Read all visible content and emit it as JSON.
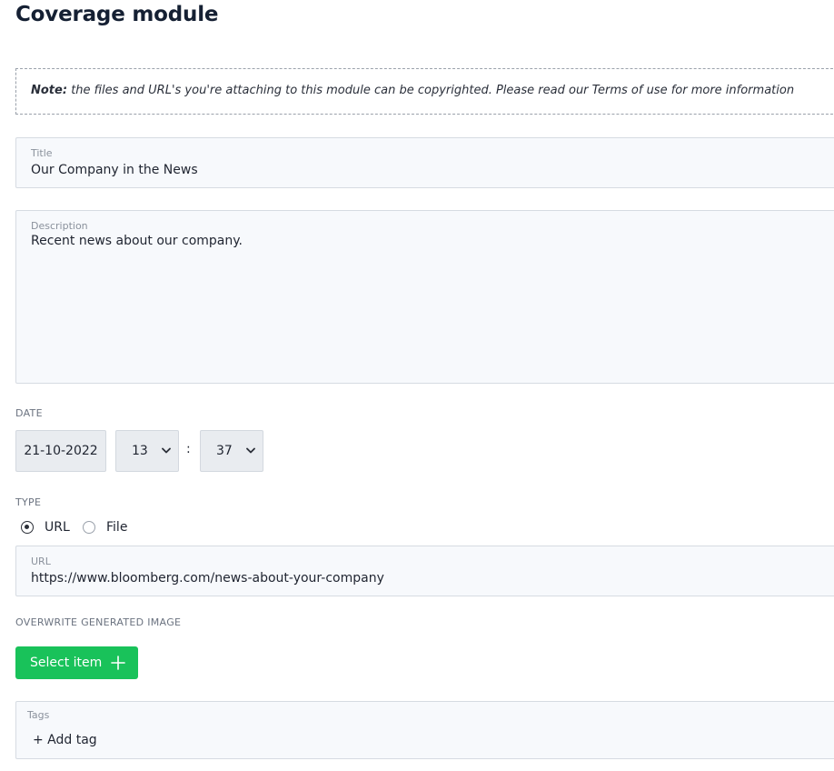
{
  "page": {
    "title": "Coverage module"
  },
  "note": {
    "prefix": "Note:",
    "text": "the files and URL's you're attaching to this module can be copyrighted. Please read our Terms of use for more information"
  },
  "title_field": {
    "label": "Title",
    "value": "Our Company in the News"
  },
  "description_field": {
    "label": "Description",
    "value": "Recent news about our company."
  },
  "date": {
    "section_label": "DATE",
    "date_value": "21-10-2022",
    "hour_value": "13",
    "separator": ":",
    "minute_value": "37"
  },
  "type": {
    "section_label": "TYPE",
    "options": [
      {
        "label": "URL",
        "selected": true
      },
      {
        "label": "File",
        "selected": false
      }
    ]
  },
  "url_field": {
    "label": "URL",
    "value": "https://www.bloomberg.com/news-about-your-company"
  },
  "overwrite_image": {
    "section_label": "OVERWRITE GENERATED IMAGE",
    "button_label": "Select item",
    "button_icon": "plus-icon",
    "button_color": "#19c25a"
  },
  "tags_field": {
    "label": "Tags",
    "add_tag_label": "+ Add tag"
  }
}
